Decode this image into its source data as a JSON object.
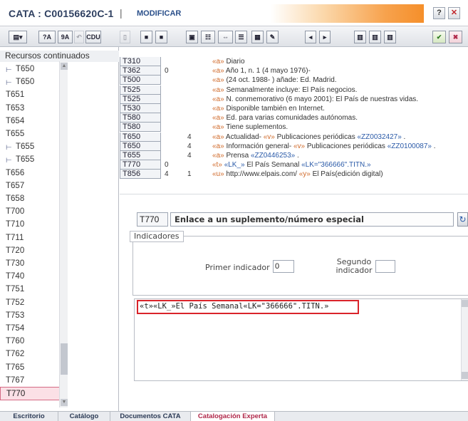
{
  "window": {
    "title": "CATA : C00156620C-1",
    "separator": "|",
    "mode": "MODIFICAR",
    "help_label": "?",
    "close_label": "✕"
  },
  "toolbar": {
    "abc_label": "?A",
    "sort_label": "9A",
    "cdu_label": "CDU"
  },
  "sidebar": {
    "header": "Recursos continuados",
    "items": [
      {
        "label": "T650",
        "icon": "tree-branch-icon"
      },
      {
        "label": "T650",
        "icon": "tree-branch-icon"
      },
      {
        "label": "T651",
        "icon": ""
      },
      {
        "label": "T653",
        "icon": ""
      },
      {
        "label": "T654",
        "icon": ""
      },
      {
        "label": "T655",
        "icon": ""
      },
      {
        "label": "T655",
        "icon": "tree-branch-icon"
      },
      {
        "label": "T655",
        "icon": "tree-branch-icon"
      },
      {
        "label": "T656",
        "icon": ""
      },
      {
        "label": "T657",
        "icon": ""
      },
      {
        "label": "T658",
        "icon": ""
      },
      {
        "label": "T700",
        "icon": ""
      },
      {
        "label": "T710",
        "icon": ""
      },
      {
        "label": "T711",
        "icon": ""
      },
      {
        "label": "T720",
        "icon": ""
      },
      {
        "label": "T730",
        "icon": ""
      },
      {
        "label": "T740",
        "icon": ""
      },
      {
        "label": "T751",
        "icon": ""
      },
      {
        "label": "T752",
        "icon": ""
      },
      {
        "label": "T753",
        "icon": ""
      },
      {
        "label": "T754",
        "icon": ""
      },
      {
        "label": "T760",
        "icon": ""
      },
      {
        "label": "T762",
        "icon": ""
      },
      {
        "label": "T765",
        "icon": ""
      },
      {
        "label": "T767",
        "icon": ""
      },
      {
        "label": "T770",
        "icon": ""
      }
    ],
    "selected_label": "T770"
  },
  "record_rows": [
    {
      "tag": "T310",
      "ind1": "",
      "ind2": "",
      "value": "«a» Diario"
    },
    {
      "tag": "T362",
      "ind1": "0",
      "ind2": "",
      "value": "«a» Año 1, n. 1 (4 mayo 1976)-"
    },
    {
      "tag": "T500",
      "ind1": "",
      "ind2": "",
      "value": "«a» (24 oct. 1988- ) añade: Ed. Madrid."
    },
    {
      "tag": "T525",
      "ind1": "",
      "ind2": "",
      "value": "«a» Semanalmente incluye: El País negocios."
    },
    {
      "tag": "T525",
      "ind1": "",
      "ind2": "",
      "value": "«a» N. conmemorativo (6 mayo 2001): El País de nuestras vidas."
    },
    {
      "tag": "T530",
      "ind1": "",
      "ind2": "",
      "value": "«a» Disponible también en Internet."
    },
    {
      "tag": "T580",
      "ind1": "",
      "ind2": "",
      "value": "«a» Ed. para varias comunidades autónomas."
    },
    {
      "tag": "T580",
      "ind1": "",
      "ind2": "",
      "value": "«a» Tiene suplementos."
    },
    {
      "tag": "T650",
      "ind1": "",
      "ind2": "4",
      "value": "«a» Actualidad- «v» Publicaciones periódicas «ZZ0032427» ."
    },
    {
      "tag": "T650",
      "ind1": "",
      "ind2": "4",
      "value": "«a» Información general- «v» Publicaciones periódicas «ZZ0100087» ."
    },
    {
      "tag": "T655",
      "ind1": "",
      "ind2": "4",
      "value": "«a» Prensa «ZZ0446253» ."
    },
    {
      "tag": "T770",
      "ind1": "0",
      "ind2": "",
      "value": "«t» «LK_» El País Semanal «LK=\"366666\".TITN.»"
    },
    {
      "tag": "T856",
      "ind1": "4",
      "ind2": "1",
      "value": "«u» http://www.elpais.com/ «y» El País(edición digital)"
    }
  ],
  "editor": {
    "field_tag": "T770",
    "field_title": "Enlace a un suplemento/número especial",
    "indicators_legend": "Indicadores",
    "first_indicator_label": "Primer indicador",
    "first_indicator_value": "0",
    "second_indicator_label": "Segundo indicador",
    "second_indicator_value": "",
    "content_value": "«t»«LK_»El País Semanal«LK=\"366666\".TITN.»"
  },
  "tabs": [
    {
      "label": "Escritorio",
      "active": false
    },
    {
      "label": "Catálogo",
      "active": false
    },
    {
      "label": "Documentos CATA",
      "active": false
    },
    {
      "label": "Catalogación Experta",
      "active": true
    }
  ],
  "colors": {
    "highlight": "#d9232a",
    "accent": "#f58f2a",
    "subfield": "#d06a2a",
    "link": "#2a5aa8"
  }
}
